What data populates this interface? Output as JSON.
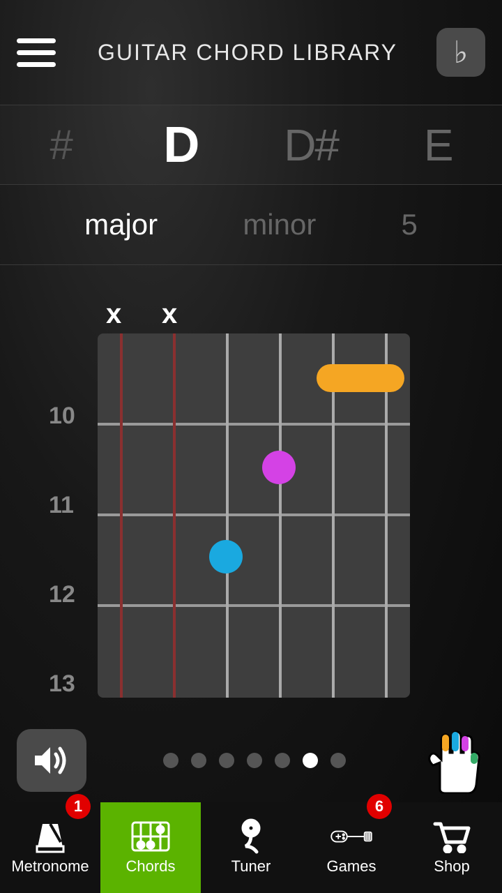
{
  "header": {
    "title": "GUITAR CHORD LIBRARY",
    "flat_symbol": "♭"
  },
  "notes": {
    "partial_left": "#",
    "items": [
      "D",
      "D#",
      "E"
    ],
    "active_index": 0
  },
  "types": {
    "items": [
      "major",
      "minor",
      "5"
    ],
    "active_index": 0
  },
  "diagram": {
    "fret_labels": [
      "10",
      "11",
      "12",
      "13"
    ],
    "muted_strings": [
      "x",
      "x"
    ],
    "fingers": [
      {
        "type": "barre",
        "fret": 1,
        "from_string": 5,
        "to_string": 6,
        "color": "#f5a623"
      },
      {
        "type": "dot",
        "fret": 2,
        "string": 4,
        "color": "#d442e5"
      },
      {
        "type": "dot",
        "fret": 3,
        "string": 3,
        "color": "#1aa9e0"
      }
    ]
  },
  "pagination": {
    "count": 7,
    "active": 5
  },
  "tabs": {
    "items": [
      {
        "label": "Metronome",
        "icon": "metronome",
        "badge": "1"
      },
      {
        "label": "Chords",
        "icon": "chords",
        "badge": null,
        "active": true
      },
      {
        "label": "Tuner",
        "icon": "tuner",
        "badge": null
      },
      {
        "label": "Games",
        "icon": "games",
        "badge": "6"
      },
      {
        "label": "Shop",
        "icon": "shop",
        "badge": null
      }
    ]
  }
}
